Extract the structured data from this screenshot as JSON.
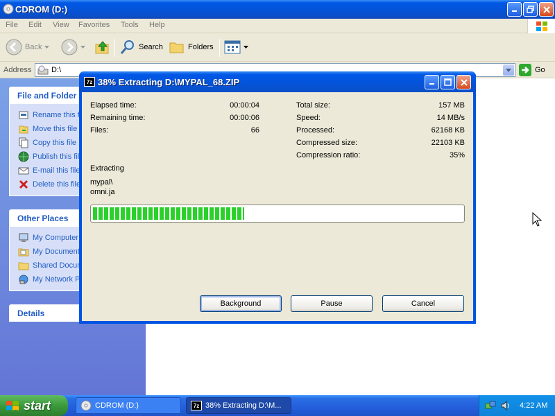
{
  "explorer": {
    "title": "CDROM (D:)",
    "menu": [
      "File",
      "Edit",
      "View",
      "Favorites",
      "Tools",
      "Help"
    ],
    "toolbar": {
      "back": "Back",
      "search": "Search",
      "folders": "Folders"
    },
    "address": {
      "label": "Address",
      "value": "D:\\",
      "go": "Go"
    },
    "panels": {
      "file_tasks": {
        "title": "File and Folder Tasks",
        "items": [
          "Rename this file",
          "Move this file",
          "Copy this file",
          "Publish this file to the Web",
          "E-mail this file",
          "Delete this file"
        ]
      },
      "other_places": {
        "title": "Other Places",
        "items": [
          "My Computer",
          "My Documents",
          "Shared Documents",
          "My Network Places"
        ]
      },
      "details": {
        "title": "Details"
      }
    }
  },
  "dialog": {
    "icon_text": "7z",
    "title": "38% Extracting D:\\MYPAL_68.ZIP",
    "left_stats": [
      {
        "label": "Elapsed time:",
        "value": "00:00:04"
      },
      {
        "label": "Remaining time:",
        "value": "00:00:06"
      },
      {
        "label": "Files:",
        "value": "66"
      }
    ],
    "right_stats": [
      {
        "label": "Total size:",
        "value": "157 MB"
      },
      {
        "label": "Speed:",
        "value": "14 MB/s"
      },
      {
        "label": "Processed:",
        "value": "62168 KB"
      },
      {
        "label": "Compressed size:",
        "value": "22103 KB"
      },
      {
        "label": "Compression ratio:",
        "value": "35%"
      }
    ],
    "status": "Extracting",
    "path_line1": "mypal\\",
    "path_line2": "omni.ja",
    "progress_percent": 41,
    "buttons": {
      "background": "Background",
      "pause": "Pause",
      "cancel": "Cancel"
    }
  },
  "taskbar": {
    "start": "start",
    "tasks": [
      {
        "label": "CDROM (D:)",
        "state": "inactive"
      },
      {
        "label": "38% Extracting D:\\M...",
        "state": "active"
      }
    ],
    "clock": "4:22 AM"
  },
  "colors": {
    "xp_blue": "#0054e3",
    "progress_green": "#2bd12b",
    "start_green": "#3c9a3c",
    "link_blue": "#215dc6"
  }
}
